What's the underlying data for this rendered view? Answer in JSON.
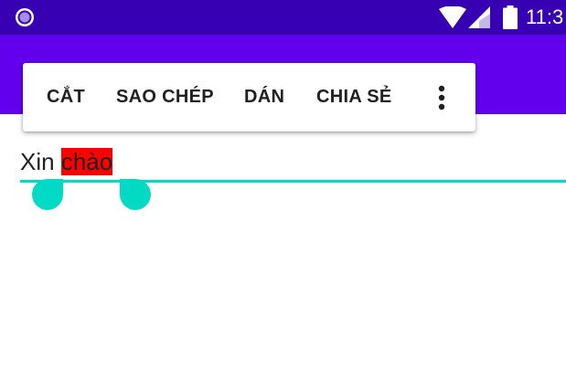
{
  "status_bar": {
    "time": "11:3",
    "icons": [
      "app-notification-icon",
      "wifi-icon",
      "cell-signal-icon",
      "battery-icon"
    ]
  },
  "selection_toolbar": {
    "items": [
      {
        "label": "CẮT"
      },
      {
        "label": "SAO CHÉP"
      },
      {
        "label": "DÁN"
      },
      {
        "label": "CHIA SẺ"
      }
    ],
    "more_icon": "more-vert-icon"
  },
  "edit_field": {
    "text_before_selection": "Xin ",
    "selected_text": "chào"
  },
  "colors": {
    "status_bar": "#3700b3",
    "app_bar": "#6200ee",
    "accent": "#03dac5",
    "selection_highlight": "#ff0000",
    "text": "#202020"
  }
}
